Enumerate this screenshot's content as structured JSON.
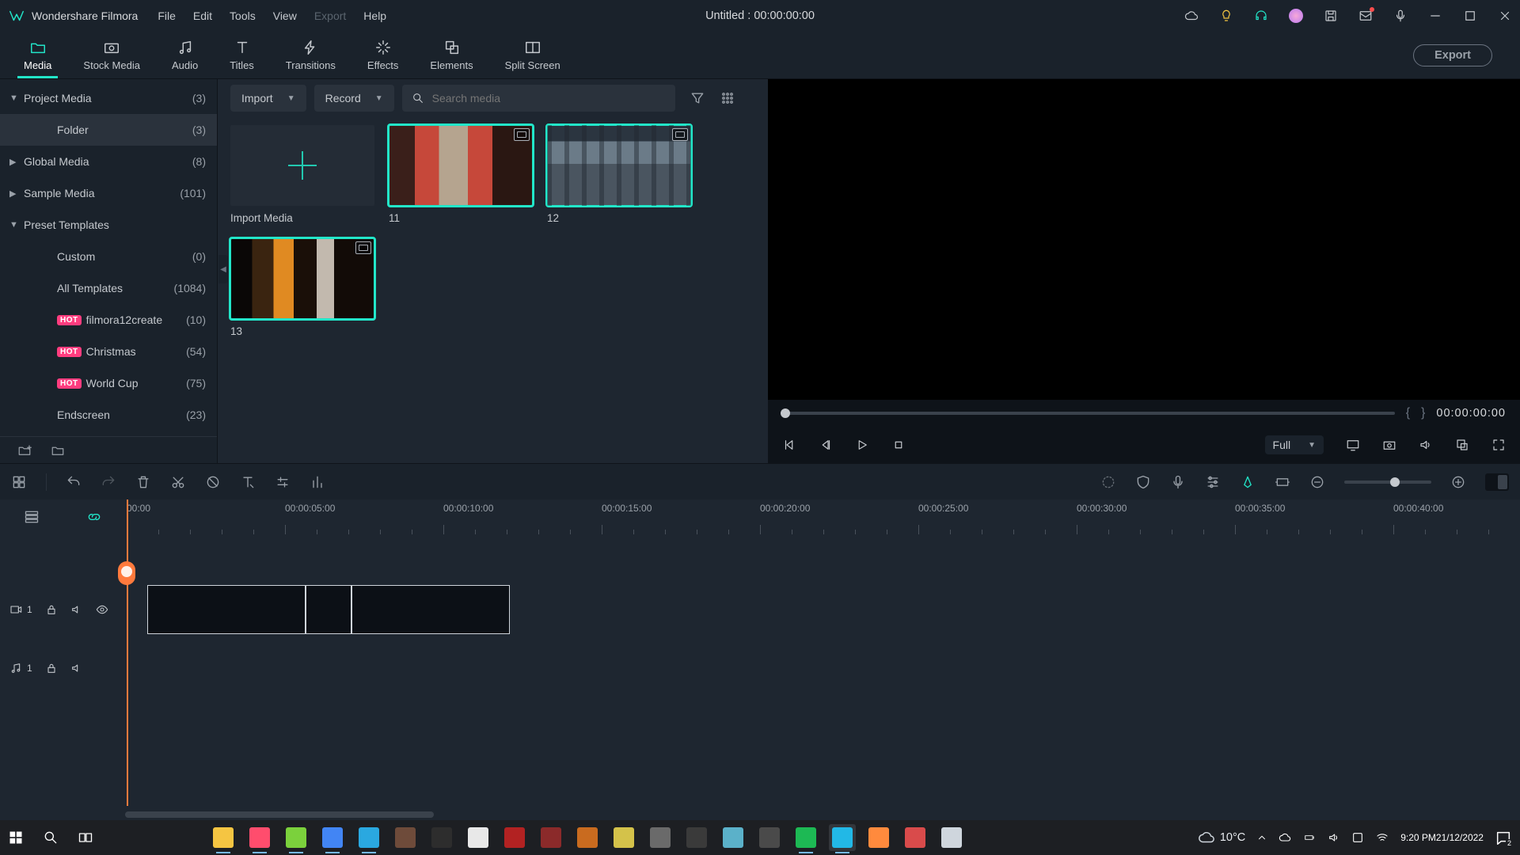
{
  "app_name": "Wondershare Filmora",
  "menus": [
    "File",
    "Edit",
    "Tools",
    "View",
    "Export",
    "Help"
  ],
  "disabled_menu": "Export",
  "doc_title": "Untitled :  00:00:00:00",
  "export_btn": "Export",
  "tabs": [
    {
      "label": "Media",
      "icon": "folder"
    },
    {
      "label": "Stock Media",
      "icon": "camera"
    },
    {
      "label": "Audio",
      "icon": "music"
    },
    {
      "label": "Titles",
      "icon": "text"
    },
    {
      "label": "Transitions",
      "icon": "bolt"
    },
    {
      "label": "Effects",
      "icon": "sparkle"
    },
    {
      "label": "Elements",
      "icon": "layers"
    },
    {
      "label": "Split Screen",
      "icon": "split"
    }
  ],
  "tree": [
    {
      "arrow": "▼",
      "label": "Project Media",
      "count": "(3)",
      "indent": 0
    },
    {
      "arrow": "",
      "label": "Folder",
      "count": "(3)",
      "indent": 1,
      "selected": true
    },
    {
      "arrow": "▶",
      "label": "Global Media",
      "count": "(8)",
      "indent": 0
    },
    {
      "arrow": "▶",
      "label": "Sample Media",
      "count": "(101)",
      "indent": 0
    },
    {
      "arrow": "▼",
      "label": "Preset Templates",
      "count": "",
      "indent": 0
    },
    {
      "arrow": "",
      "label": "Custom",
      "count": "(0)",
      "indent": 1
    },
    {
      "arrow": "",
      "label": "All Templates",
      "count": "(1084)",
      "indent": 1
    },
    {
      "arrow": "",
      "label": "filmora12create",
      "count": "(10)",
      "indent": 1,
      "hot": true
    },
    {
      "arrow": "",
      "label": "Christmas",
      "count": "(54)",
      "indent": 1,
      "hot": true
    },
    {
      "arrow": "",
      "label": "World Cup",
      "count": "(75)",
      "indent": 1,
      "hot": true
    },
    {
      "arrow": "",
      "label": "Endscreen",
      "count": "(23)",
      "indent": 1
    }
  ],
  "hot_label": "HOT",
  "import_dd": "Import",
  "record_dd": "Record",
  "search_placeholder": "Search media",
  "import_tile": "Import Media",
  "clips": [
    {
      "name": "11",
      "scene": "scene1"
    },
    {
      "name": "12",
      "scene": "scene2"
    },
    {
      "name": "13",
      "scene": "scene3"
    }
  ],
  "preview_tc": "00:00:00:00",
  "quality": "Full",
  "ruler": [
    "00:00",
    "00:00:05:00",
    "00:00:10:00",
    "00:00:15:00",
    "00:00:20:00",
    "00:00:25:00",
    "00:00:30:00",
    "00:00:35:00",
    "00:00:40:00"
  ],
  "track_video_num": "1",
  "track_audio_num": "1",
  "taskbar": {
    "temp": "10°C",
    "time": "9:20 PM",
    "date": "21/12/2022",
    "notif": "2"
  }
}
